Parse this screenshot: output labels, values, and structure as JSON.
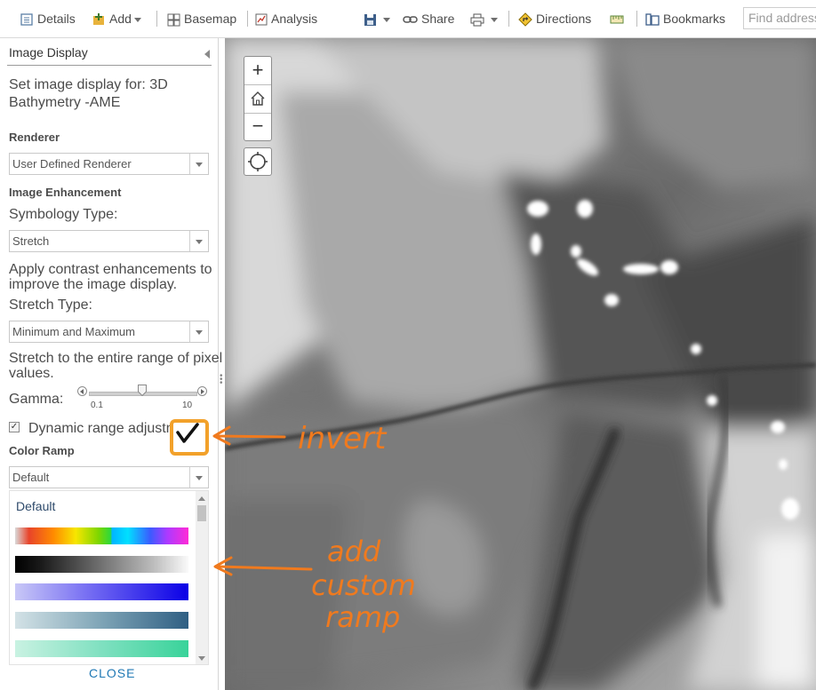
{
  "toolbar": {
    "details": "Details",
    "add": "Add",
    "basemap": "Basemap",
    "analysis": "Analysis",
    "share": "Share",
    "directions": "Directions",
    "bookmarks": "Bookmarks",
    "search_placeholder": "Find address"
  },
  "panel": {
    "title": "Image Display",
    "subtitle_line1": "Set image display for: 3D",
    "subtitle_line2": "Bathymetry -AME",
    "renderer_header": "Renderer",
    "renderer_value": "User Defined Renderer",
    "enhancement_header": "Image Enhancement",
    "symbology_label": "Symbology Type:",
    "symbology_value": "Stretch",
    "contrast_line1": "Apply contrast enhancements to",
    "contrast_line2": "improve the image display.",
    "stretch_label": "Stretch Type:",
    "stretch_value": "Minimum and Maximum",
    "stretch_desc_line1": "Stretch to the entire range of pixel",
    "stretch_desc_line2": "values.",
    "gamma_label": "Gamma:",
    "gamma_min": "0.1",
    "gamma_max": "10",
    "gamma_value": 0.5,
    "dynamic_range_label": "Dynamic range adjustmen",
    "dynamic_range_checked": true,
    "color_ramp_header": "Color Ramp",
    "color_ramp_value": "Default",
    "ramp_list_default": "Default",
    "close": "CLOSE"
  },
  "annotations": {
    "invert": "invert",
    "add_line1": "add",
    "add_line2": "custom",
    "add_line3": "ramp",
    "color": "#f07a1e"
  },
  "colors": {
    "accent": "#1f78b4",
    "annotation": "#f07a1e",
    "checkbox_highlight": "#f2a12a"
  }
}
